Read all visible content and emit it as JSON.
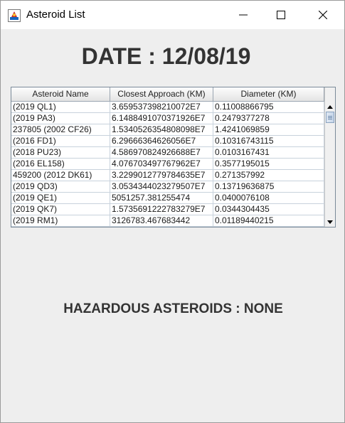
{
  "window": {
    "title": "Asteroid List"
  },
  "date_label": "DATE : 12/08/19",
  "table": {
    "headers": [
      "Asteroid Name",
      "Closest Approach (KM)",
      "Diameter (KM)"
    ],
    "rows": [
      [
        "(2019 QL1)",
        "3.659537398210072E7",
        "0.11008866795"
      ],
      [
        "(2019 PA3)",
        "6.1488491070371926E7",
        "0.2479377278"
      ],
      [
        "237805 (2002 CF26)",
        "1.5340526354808098E7",
        "1.4241069859"
      ],
      [
        "(2016 FD1)",
        "6.29666364626056E7",
        "0.10316743115"
      ],
      [
        "(2018 PU23)",
        "4.586970824926688E7",
        "0.0103167431"
      ],
      [
        "(2016 EL158)",
        "4.076703497767962E7",
        "0.3577195015"
      ],
      [
        "459200 (2012 DK61)",
        "3.2299012779784635E7",
        "0.271357992"
      ],
      [
        "(2019 QD3)",
        "3.0534344023279507E7",
        "0.13719636875"
      ],
      [
        "(2019 QE1)",
        "5051257.381255474",
        "0.0400076108"
      ],
      [
        "(2019 QK7)",
        "1.5735691222783279E7",
        "0.0344304435"
      ],
      [
        "(2019 RM1)",
        "3126783.467683442",
        "0.01189440215"
      ]
    ]
  },
  "hazard_label": "HAZARDOUS ASTEROIDS : NONE",
  "icons": {
    "app": "java-app-icon",
    "minimize": "minimize-icon",
    "maximize": "maximize-icon",
    "close": "close-icon",
    "scroll_up": "arrow-up-icon",
    "scroll_down": "arrow-down-icon"
  },
  "colors": {
    "heading_text": "#333333",
    "window_bg": "#eeeeee",
    "grid_line": "#c8d2dc"
  }
}
